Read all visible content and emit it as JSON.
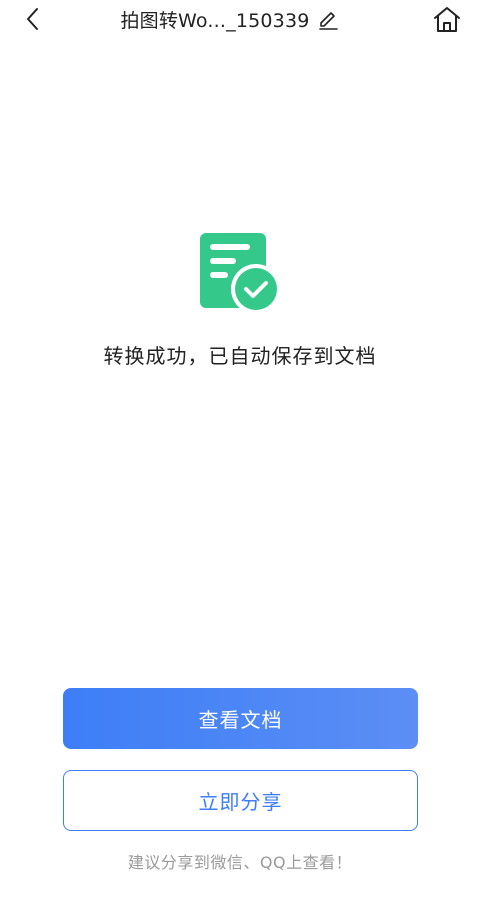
{
  "header": {
    "title": "拍图转Wo..._150339",
    "back_icon": "chevron-left-icon",
    "edit_icon": "pencil-icon",
    "home_icon": "home-icon"
  },
  "main": {
    "status_icon": "document-check-icon",
    "status_text": "转换成功，已自动保存到文档"
  },
  "actions": {
    "view_label": "查看文档",
    "share_label": "立即分享"
  },
  "footer": {
    "hint": "建议分享到微信、QQ上查看！"
  },
  "colors": {
    "accent": "#3d7ef7",
    "success": "#34c98a",
    "hint": "#9a9a9a"
  }
}
